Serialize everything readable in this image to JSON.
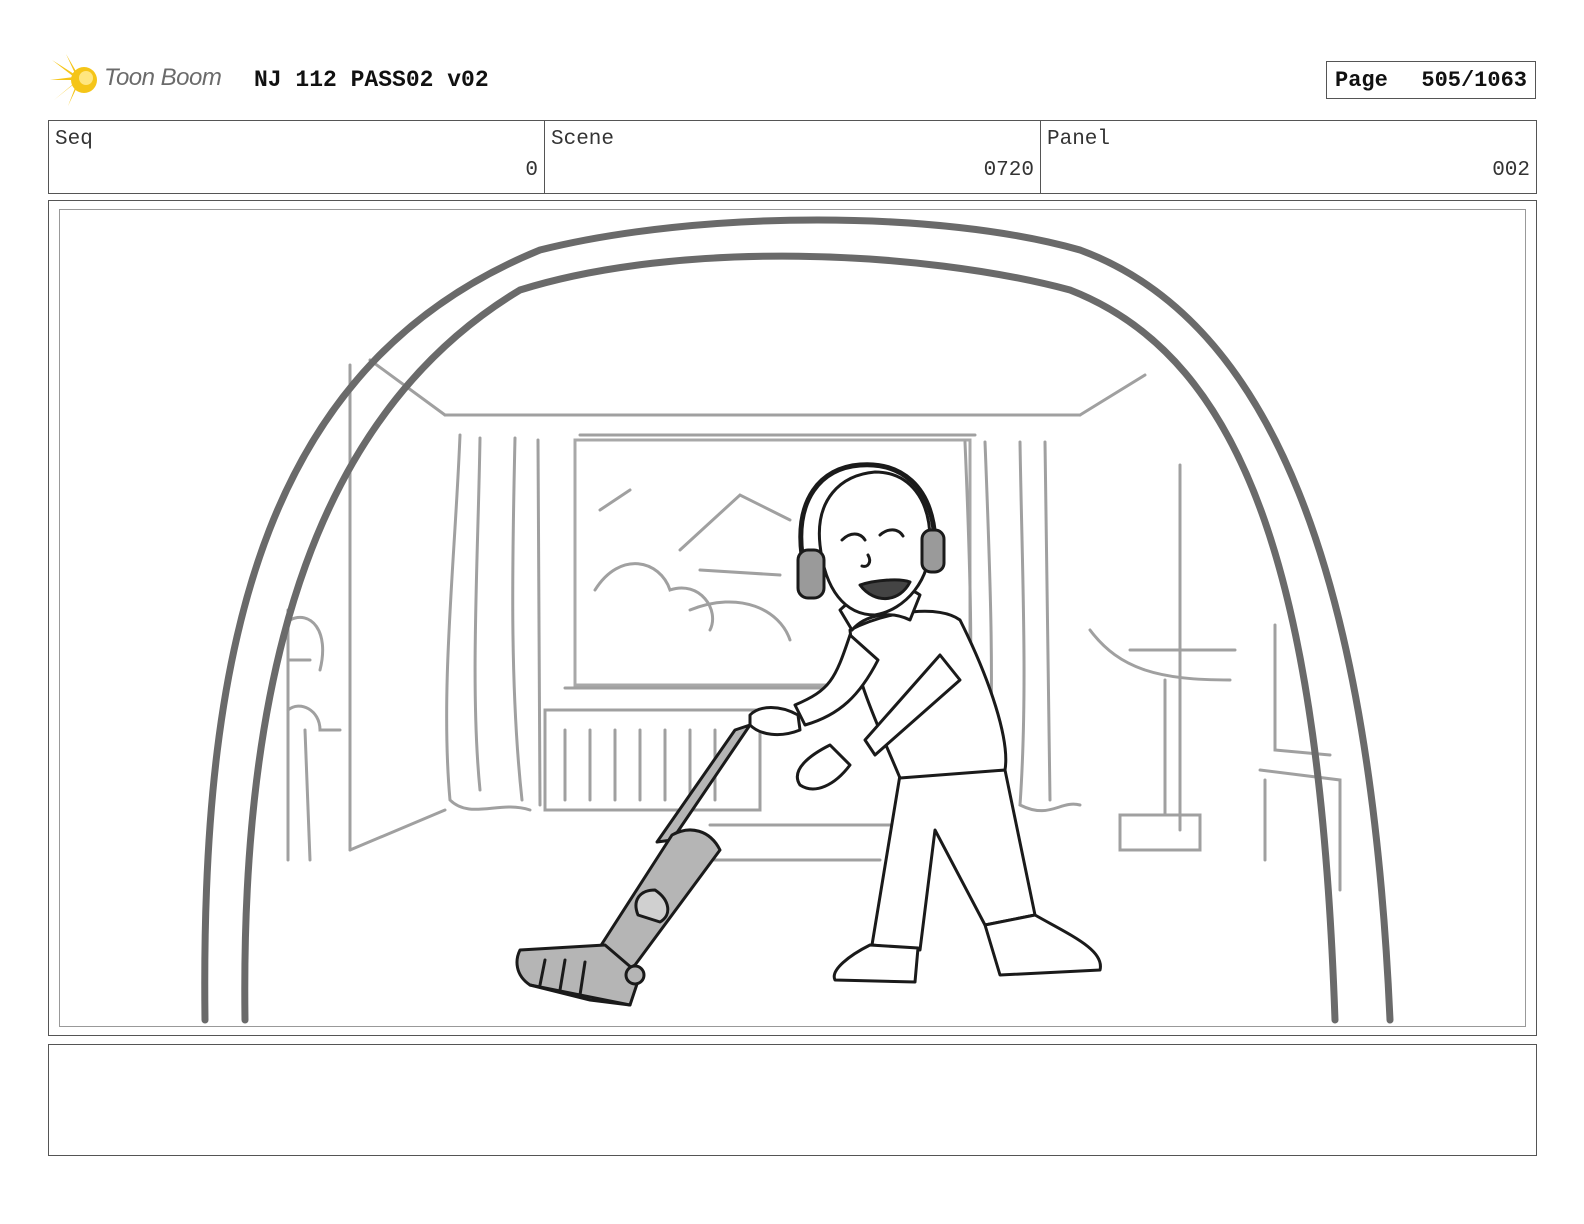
{
  "header": {
    "logo_text": "Toon Boom",
    "title": "NJ 112 PASS02 v02",
    "page_label": "Page",
    "page_value": "505/1063"
  },
  "info": {
    "seq_label": "Seq",
    "seq_value": "0",
    "scene_label": "Scene",
    "scene_value": "0720",
    "panel_label": "Panel",
    "panel_value": "002"
  },
  "notes": {
    "text": ""
  },
  "colors": {
    "logo_star": "#f5c518",
    "logo_text": "#6b6b6b",
    "border": "#555555",
    "sketch_dark": "#1a1a1a",
    "sketch_grey": "#9a9a9a",
    "vacuum_fill": "#b5b5b5"
  }
}
